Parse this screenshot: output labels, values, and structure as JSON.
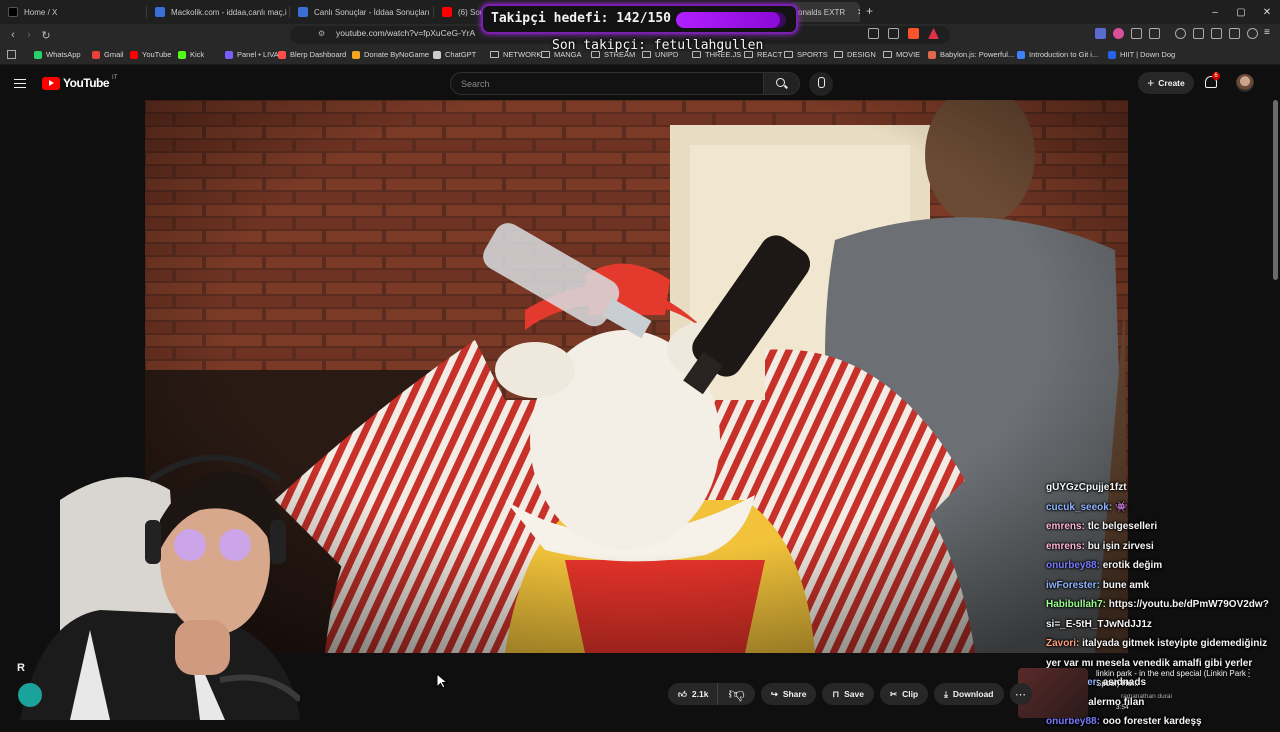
{
  "browser": {
    "tabs": [
      {
        "label": "Home / X",
        "color": "#000000"
      },
      {
        "label": "Mackolik.com - iddaa,canlı maç,iddaa",
        "color": "#3b6fd6"
      },
      {
        "label": "Canlı Sonuçlar - İddaa Sonuçları | Ma",
        "color": "#3b6fd6"
      },
      {
        "label": "(6) Sound",
        "color": "#ff0000"
      },
      {
        "label": "onalds EXTR",
        "color": "#ff0000"
      }
    ],
    "url": "youtube.com/watch?v=fpXuCeG-YrA",
    "bookmarks": [
      {
        "label": "WhatsApp",
        "type": "site",
        "color": "#25d366"
      },
      {
        "label": "Gmail",
        "type": "site",
        "color": "#ea4335"
      },
      {
        "label": "YouTube",
        "type": "site",
        "color": "#ff0000"
      },
      {
        "label": "Kick",
        "type": "site",
        "color": "#53fc18"
      },
      {
        "label": "Panel • LIVAD",
        "type": "site",
        "color": "#7b5cff"
      },
      {
        "label": "Blerp Dashboard",
        "type": "site",
        "color": "#ff4d4d"
      },
      {
        "label": "Donate ByNoGame",
        "type": "site",
        "color": "#f5a623"
      },
      {
        "label": "ChatGPT",
        "type": "site",
        "color": "#cccccc"
      },
      {
        "label": "NETWORK",
        "type": "folder"
      },
      {
        "label": "MANGA",
        "type": "folder"
      },
      {
        "label": "STREAM",
        "type": "folder"
      },
      {
        "label": "UNIPD",
        "type": "folder"
      },
      {
        "label": "THREE.JS",
        "type": "folder"
      },
      {
        "label": "REACT",
        "type": "folder"
      },
      {
        "label": "SPORTS",
        "type": "folder"
      },
      {
        "label": "DESIGN",
        "type": "folder"
      },
      {
        "label": "MOVIE",
        "type": "folder"
      },
      {
        "label": "Babylon.js: Powerful...",
        "type": "site",
        "color": "#e0684b"
      },
      {
        "label": "Introduction to Git i...",
        "type": "site",
        "color": "#3b82f6"
      },
      {
        "label": "HIIT | Down Dog",
        "type": "site",
        "color": "#2563eb"
      }
    ]
  },
  "overlay": {
    "goal_text": "Takipçi hedefi: 142/150",
    "goal_progress": 0.9467,
    "last_follower": "Son takipçi: fetullahgullen"
  },
  "youtube": {
    "logo": "YouTube",
    "region": "IT",
    "search_placeholder": "Search",
    "create_label": "Create",
    "notification_count": "6",
    "actions": {
      "likes": "2.1k",
      "share": "Share",
      "save": "Save",
      "clip": "Clip",
      "download": "Download"
    },
    "side_initial": "R",
    "mini_player": {
      "title": "linkin park - in the end special (Linkin Park Spoof) Ho...",
      "channel": "ramanathan durai",
      "length": "3:54"
    }
  },
  "chat": [
    {
      "user": "",
      "msg": "gUYGzCpujje1fzt",
      "color": "#ffffff"
    },
    {
      "user": "cucuk_seeok:",
      "msg": "👾",
      "color": "#8fb4ff"
    },
    {
      "user": "emrens:",
      "msg": "tlc belgeselleri",
      "color": "#ffb3d9"
    },
    {
      "user": "emrens:",
      "msg": "bu işin zirvesi",
      "color": "#ffb3d9"
    },
    {
      "user": "onurbey88:",
      "msg": "erotik değim",
      "color": "#7a7aff"
    },
    {
      "user": "iwForester:",
      "msg": "bune amk",
      "color": "#8fb4ff"
    },
    {
      "user": "Habibullah7:",
      "msg": "https://youtu.be/dPmW79OV2dw?si=_E-5tH_TJwNdJJ1z",
      "color": "#9cff8f"
    },
    {
      "user": "Zavori:",
      "msg": "italyada gitmek isteyipte gidemediğiniz yer var mı mesela venedik amalfi gibi yerler",
      "color": "#ff9d7a"
    },
    {
      "user": "iwForester:",
      "msg": "asıdnads",
      "color": "#8fb4ff"
    },
    {
      "user": "Zavori:",
      "msg": "palermo filan",
      "color": "#ff9d7a"
    },
    {
      "user": "onurbey88:",
      "msg": "ooo forester kardeşş",
      "color": "#7a7aff"
    }
  ]
}
